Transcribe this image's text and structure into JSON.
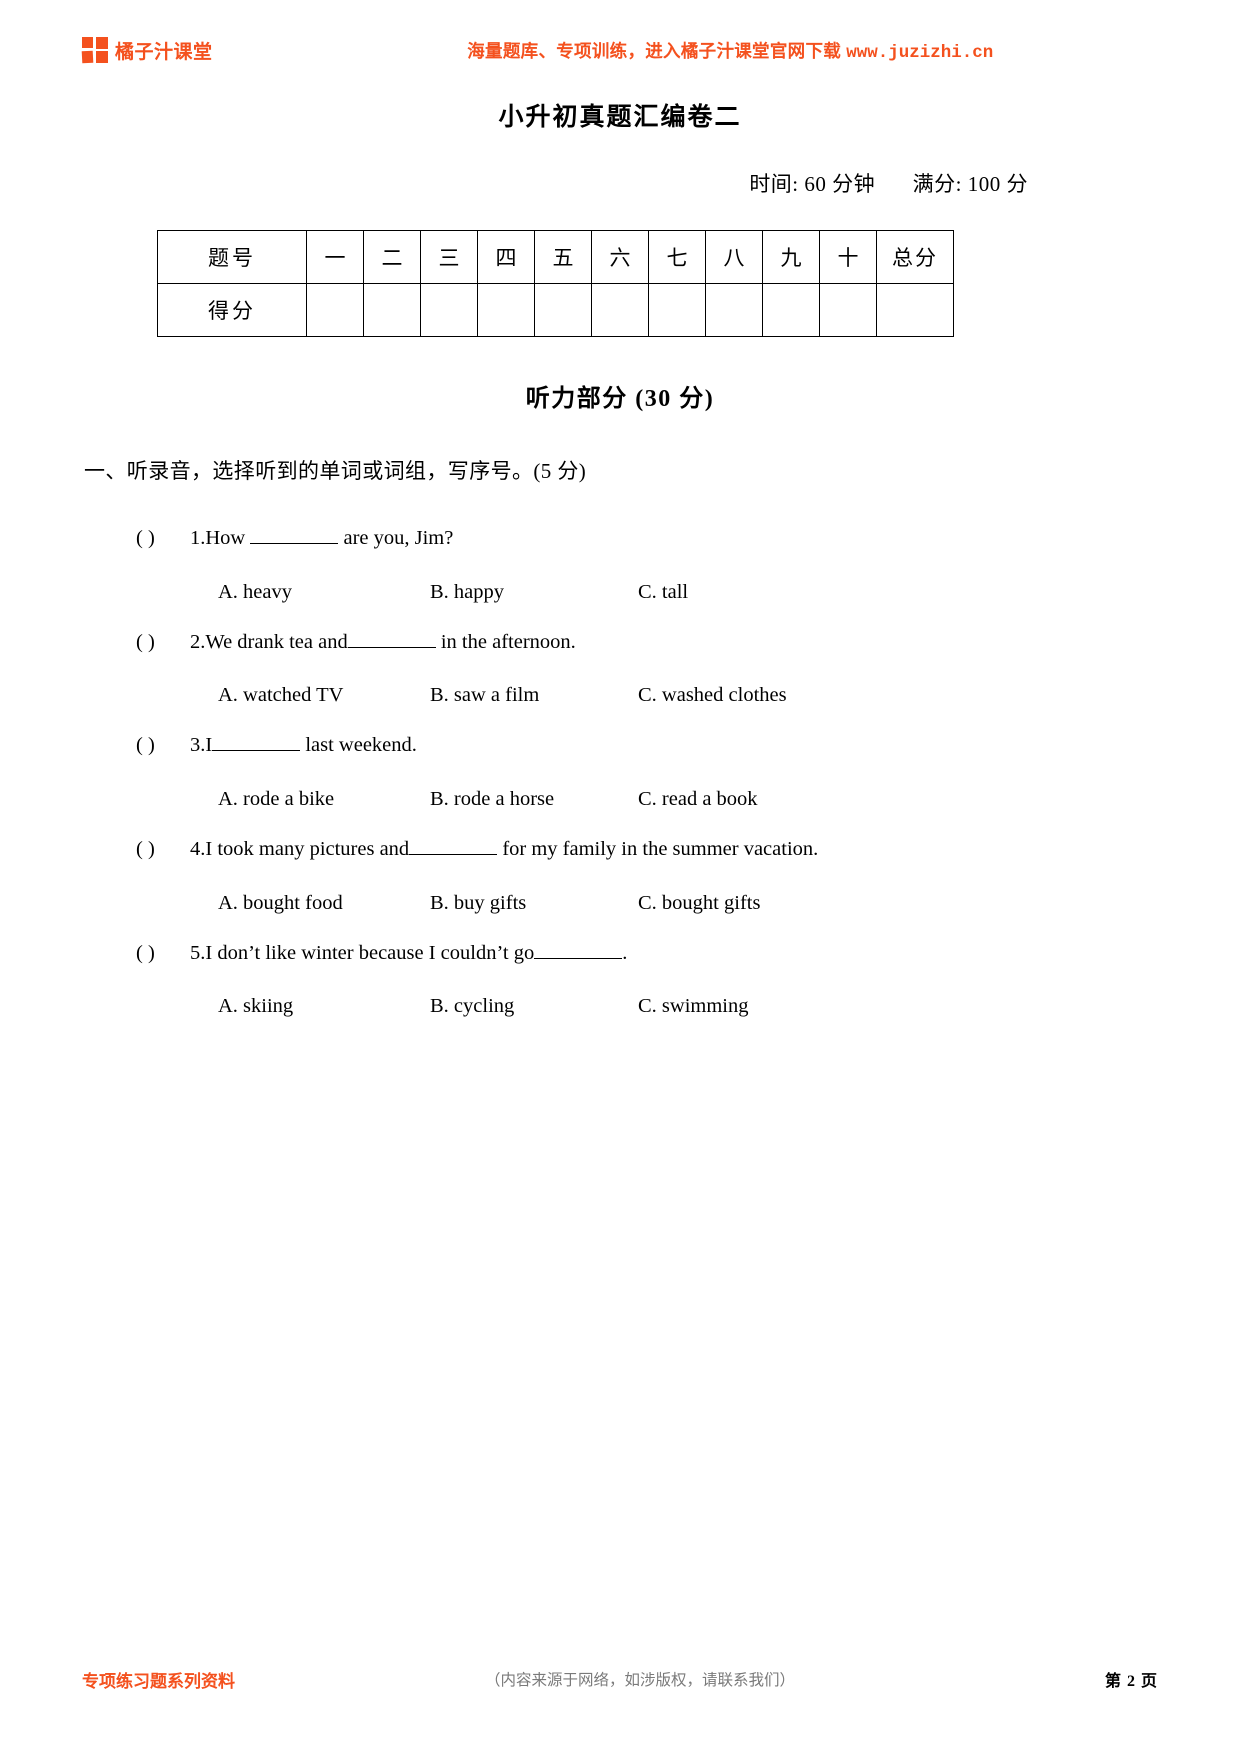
{
  "header": {
    "brand_name": "橘子汁课堂",
    "logo_icon": "four-square-logo-icon",
    "promo_text": "海量题库、专项训练，进入橘子汁课堂官网下载",
    "promo_url": "www.juzizhi.cn",
    "accent_color": "#f4511e"
  },
  "title": "小升初真题汇编卷二",
  "meta": {
    "time_label": "时间: 60 分钟",
    "total_label": "满分: 100 分"
  },
  "score_table": {
    "row_labels": [
      "题号",
      "得分"
    ],
    "columns": [
      "一",
      "二",
      "三",
      "四",
      "五",
      "六",
      "七",
      "八",
      "九",
      "十",
      "总分"
    ],
    "score_values": [
      "",
      "",
      "",
      "",
      "",
      "",
      "",
      "",
      "",
      "",
      ""
    ]
  },
  "section": {
    "heading": "听力部分 (30 分)"
  },
  "instruction": "一、听录音，选择听到的单词或词组，写序号。(5 分)",
  "questions": [
    {
      "paren": "(     )",
      "number": "1.",
      "stem_before": "How ",
      "stem_after": " are you, Jim?",
      "options": [
        "A. heavy",
        "B. happy",
        "C. tall"
      ]
    },
    {
      "paren": "(     )",
      "number": "2.",
      "stem_before": "We drank tea and",
      "stem_after": " in the afternoon.",
      "options": [
        "A. watched TV",
        "B. saw a film",
        "C. washed clothes"
      ]
    },
    {
      "paren": "(     )",
      "number": "3.",
      "stem_before": "I",
      "stem_after": " last weekend.",
      "options": [
        "A. rode a bike",
        "B. rode a horse",
        "C. read a book"
      ]
    },
    {
      "paren": "(     )",
      "number": "4.",
      "stem_before": "I took many pictures and",
      "stem_after": " for my family in the summer vacation.",
      "options": [
        "A. bought food",
        "B. buy gifts",
        "C. bought gifts"
      ]
    },
    {
      "paren": "(     )",
      "number": "5.",
      "stem_before": "I don’t like winter because I couldn’t go",
      "stem_after": ".",
      "options": [
        "A. skiing",
        "B. cycling",
        "C. swimming"
      ]
    }
  ],
  "footer": {
    "left_label": "专项练习题系列资料",
    "center_note": "（内容来源于网络，如涉版权，请联系我们）",
    "page_label": "第 2 页"
  }
}
